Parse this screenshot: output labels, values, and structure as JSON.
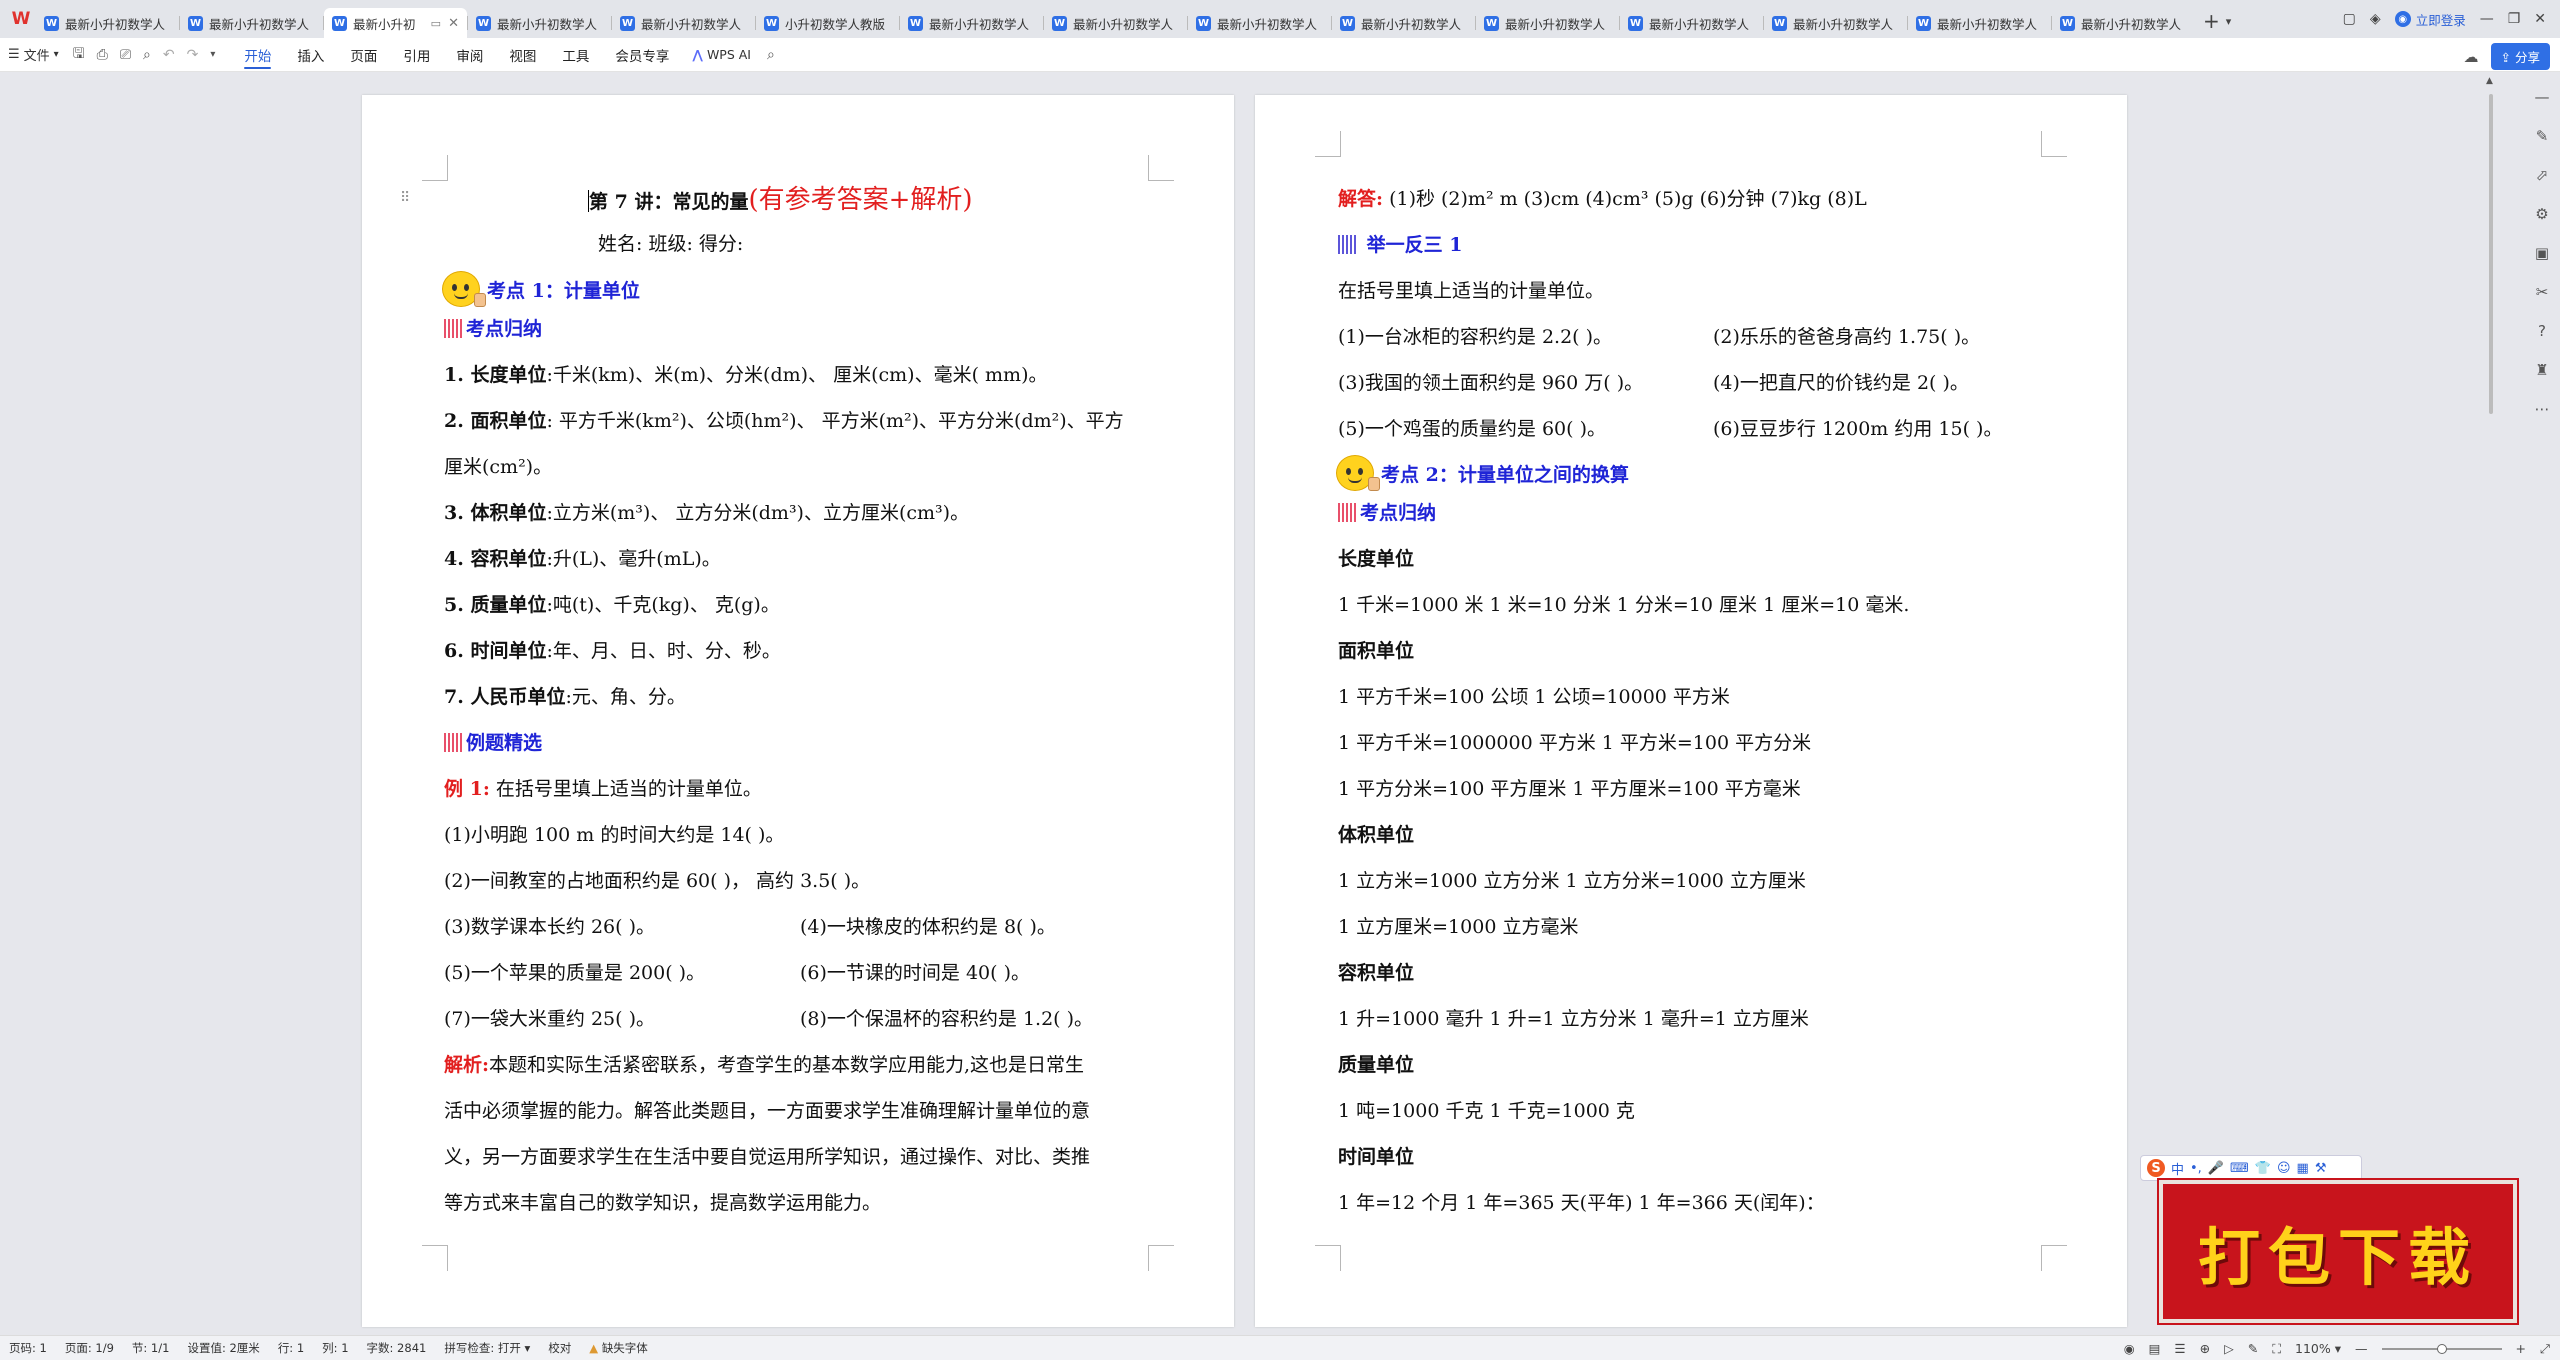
{
  "app": {
    "logo": "W"
  },
  "tabs": [
    {
      "label": "最新小升初数学人",
      "active": false
    },
    {
      "label": "最新小升初数学人",
      "active": false
    },
    {
      "label": "最新小升初",
      "active": true
    },
    {
      "label": "最新小升初数学人",
      "active": false
    },
    {
      "label": "最新小升初数学人",
      "active": false
    },
    {
      "label": "小升初数学人教版",
      "active": false
    },
    {
      "label": "最新小升初数学人",
      "active": false
    },
    {
      "label": "最新小升初数学人",
      "active": false
    },
    {
      "label": "最新小升初数学人",
      "active": false
    },
    {
      "label": "最新小升初数学人",
      "active": false
    },
    {
      "label": "最新小升初数学人",
      "active": false
    },
    {
      "label": "最新小升初数学人",
      "active": false
    },
    {
      "label": "最新小升初数学人",
      "active": false
    },
    {
      "label": "最新小升初数学人",
      "active": false
    },
    {
      "label": "最新小升初数学人",
      "active": false
    }
  ],
  "titlebar": {
    "login": "立即登录"
  },
  "toolbar": {
    "file": "文件",
    "menus": [
      "开始",
      "插入",
      "页面",
      "引用",
      "审阅",
      "视图",
      "工具",
      "会员专享"
    ],
    "active_menu": "开始",
    "wps_ai": "WPS AI",
    "share": "分享"
  },
  "left_page": {
    "title_main": "第 7 讲：常见的量",
    "title_suffix": "(有参考答案+解析)",
    "name_line": "姓名:                  班级:                  得分:",
    "kp1": "考点 1：计量单位",
    "kp1_summary": "考点归纳",
    "length_label": "1. 长度单位",
    "length_text": ":千米(km)、米(m)、分米(dm)、 厘米(cm)、毫米( mm)。",
    "area_label": "2. 面积单位",
    "area_text1": ": 平方千米(km²)、公顷(hm²)、 平方米(m²)、平方分米(dm²)、平方",
    "area_text2": "厘米(cm²)。",
    "volume_label": "3. 体积单位",
    "volume_text": ":立方米(m³)、 立方分米(dm³)、立方厘米(cm³)。",
    "capacity_label": "4. 容积单位",
    "capacity_text": ":升(L)、毫升(mL)。",
    "mass_label": "5. 质量单位",
    "mass_text": ":吨(t)、千克(kg)、 克(g)。",
    "time_label": "6. 时间单位",
    "time_text": ":年、月、日、时、分、秒。",
    "rmb_label": "7. 人民币单位",
    "rmb_text": ":元、角、分。",
    "examples": "例题精选",
    "ex1_label": "例 1:",
    "ex1_text": "在括号里填上适当的计量单位。",
    "q1": "(1)小明跑 100 m 的时间大约是 14(     )。",
    "q2": "(2)一间教室的占地面积约是 60(     )， 高约 3.5(     )。",
    "q3": "(3)数学课本长约 26(     )。",
    "q4": "(4)一块橡皮的体积约是 8(     )。",
    "q5": "(5)一个苹果的质量是 200(     )。",
    "q6": "(6)一节课的时间是 40(     )。",
    "q7": "(7)一袋大米重约 25(     )。",
    "q8": "(8)一个保温杯的容积约是 1.2(     )。",
    "analysis_label": "解析:",
    "analysis1": "本题和实际生活紧密联系，考查学生的基本数学应用能力,这也是日常生",
    "analysis2": "活中必须掌握的能力。解答此类题目，一方面要求学生准确理解计量单位的意",
    "analysis3": "义，另一方面要求学生在生活中要自觉运用所学知识，通过操作、对比、类推",
    "analysis4": "等方式来丰富自己的数学知识，提高数学运用能力。"
  },
  "right_page": {
    "answer_label": "解答:",
    "answer_text": "(1)秒  (2)m²  m  (3)cm  (4)cm³  (5)g  (6)分钟   (7)kg   (8)L",
    "practice": "举一反三 1",
    "practice_text": "在括号里填上适当的计量单位。",
    "p1": "(1)一台冰柜的容积约是 2.2(     )。",
    "p2": "(2)乐乐的爸爸身高约 1.75(     )。",
    "p3": "(3)我国的领土面积约是 960 万(     )。",
    "p4": "(4)一把直尺的价钱约是 2(     )。",
    "p5": "(5)一个鸡蛋的质量约是 60(     )。",
    "p6": "(6)豆豆步行 1200m 约用 15(     )。",
    "kp2": "考点 2：计量单位之间的换算",
    "kp2_summary": "考点归纳",
    "len_head": "长度单位",
    "len_line": "1 千米=1000 米      1 米=10 分米      1 分米=10 厘米      1 厘米=10 毫米.",
    "area_head": "面积单位",
    "area_l1": "1 平方千米=100 公顷               1 公顷=10000 平方米",
    "area_l2": "1  平方千米=1000000 平方米      1 平方米=100 平方分米",
    "area_l3": "1 平方分米=100 平方厘米          1 平方厘米=100 平方毫米",
    "vol_head": "体积单位",
    "vol_l1": "1 立方米=1000 立方分米       1 立方分米=1000 立方厘米",
    "vol_l2": "1 立方厘米=1000 立方毫米",
    "cap_head": "容积单位",
    "cap_l1": "1 升=1000 毫升        1 升=1 立方分米          1 毫升=1 立方厘米",
    "mass_head": "质量单位",
    "mass_l1": "1 吨=1000 千克        1 千克=1000 克",
    "time_head": "时间单位",
    "time_l1": "1 年=12 个月        1 年=365 天(平年)        1 年=366 天(闰年)："
  },
  "status": {
    "page_num": "页码: 1",
    "pages": "页面: 1/9",
    "section": "节: 1/1",
    "position": "设置值: 2厘米",
    "row": "行: 1",
    "col": "列: 1",
    "word_count": "字数: 2841",
    "spellcheck": "拼写检查: 打开",
    "proof": "校对",
    "missing_font": "缺失字体",
    "zoom": "110%"
  },
  "ime": {
    "lang": "中"
  },
  "banner": {
    "text": "打包下载"
  },
  "colors": {
    "accent": "#2f6fe5",
    "red": "#e21f1f",
    "blue": "#1f24d6",
    "banner_bg": "#c8141c",
    "banner_text": "#ffd21a"
  }
}
